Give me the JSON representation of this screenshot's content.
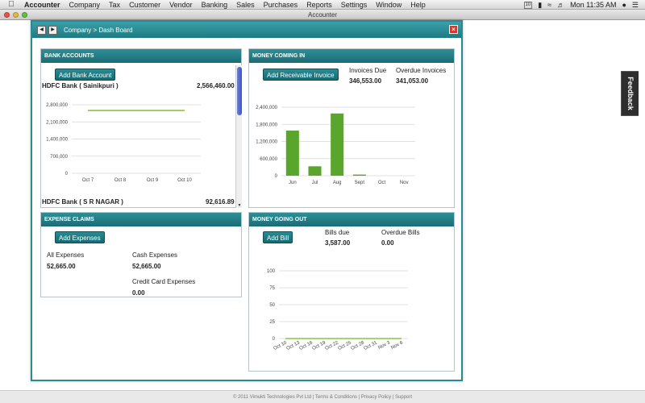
{
  "menubar": {
    "app_name": "Accounter",
    "items": [
      "Company",
      "Tax",
      "Customer",
      "Vendor",
      "Banking",
      "Sales",
      "Purchases",
      "Reports",
      "Settings",
      "Window",
      "Help"
    ],
    "calendar_day": "10",
    "clock": "Mon 11:35 AM"
  },
  "window": {
    "title": "Accounter"
  },
  "dashboard": {
    "breadcrumb": "Company > Dash Board",
    "close_glyph": "×"
  },
  "bank_accounts": {
    "title": "BANK ACCOUNTS",
    "add_button": "Add Bank Account",
    "accounts": [
      {
        "name": "HDFC Bank ( Sainikpuri )",
        "balance": "2,566,460.00"
      },
      {
        "name": "HDFC Bank ( S R NAGAR )",
        "balance": "92,616.89"
      }
    ]
  },
  "money_coming_in": {
    "title": "MONEY COMING IN",
    "add_button": "Add Receivable Invoice",
    "invoices_due_label": "Invoices Due",
    "invoices_due_value": "346,553.00",
    "overdue_label": "Overdue Invoices",
    "overdue_value": "341,053.00"
  },
  "expense_claims": {
    "title": "EXPENSE CLAIMS",
    "add_button": "Add Expenses",
    "all_label": "All Expenses",
    "all_value": "52,665.00",
    "cash_label": "Cash Expenses",
    "cash_value": "52,665.00",
    "credit_label": "Credit Card Expenses",
    "credit_value": "0.00"
  },
  "money_going_out": {
    "title": "MONEY GOING OUT",
    "add_button": "Add Bill",
    "bills_due_label": "Bills due",
    "bills_due_value": "3,587.00",
    "overdue_label": "Overdue Bills",
    "overdue_value": "0.00"
  },
  "feedback": {
    "label": "Feedback"
  },
  "footer": {
    "text": "© 2011 Vimukti Technologies Pvt Ltd | Terms & Conditions | Privacy Policy | Support"
  },
  "colors": {
    "accent": "#1e7a82",
    "bar": "#5aa52c",
    "line": "#8cc63f"
  },
  "chart_data": [
    {
      "type": "line",
      "categories": [
        "Oct 7",
        "Oct 8",
        "Oct 9",
        "Oct 10"
      ],
      "y_ticks": [
        "2,800,000",
        "2,100,000",
        "1,400,000",
        "700,000",
        "0"
      ],
      "ylim": [
        0,
        2800000
      ],
      "series": [
        {
          "values": [
            2566460,
            2566460,
            2566460,
            2566460
          ]
        }
      ],
      "grid": true
    },
    {
      "type": "bar",
      "categories": [
        "Jun",
        "Jul",
        "Aug",
        "Sept",
        "Oct",
        "Nov"
      ],
      "values": [
        1580000,
        330000,
        2180000,
        40000,
        0,
        0
      ],
      "y_ticks": [
        "2,400,000",
        "1,800,000",
        "1,200,000",
        "600,000",
        "0"
      ],
      "ylim": [
        0,
        2400000
      ],
      "grid": true
    },
    {
      "type": "line",
      "categories": [
        "Oct 10",
        "Oct 13",
        "Oct 16",
        "Oct 19",
        "Oct 22",
        "Oct 25",
        "Oct 28",
        "Oct 31",
        "Nov 3",
        "Nov 6"
      ],
      "y_ticks": [
        "100",
        "75",
        "50",
        "25",
        "0"
      ],
      "ylim": [
        0,
        100
      ],
      "series": [
        {
          "values": [
            0,
            0,
            0,
            0,
            0,
            0,
            0,
            0,
            0,
            0
          ]
        }
      ],
      "grid": true
    }
  ]
}
